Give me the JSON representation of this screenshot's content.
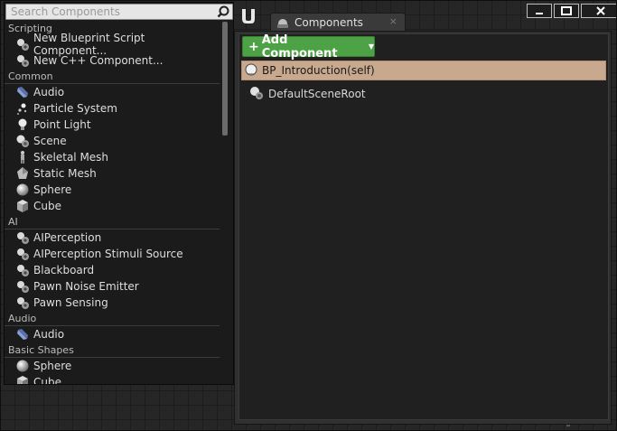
{
  "search": {
    "placeholder": "Search Components",
    "icon": "search-icon"
  },
  "scripting": {
    "header": "Scripting",
    "items": [
      {
        "label": "New Blueprint Script Component...",
        "icon": "blueprint-component-icon"
      },
      {
        "label": "New C++ Component...",
        "icon": "cpp-component-icon"
      }
    ]
  },
  "common": {
    "header": "Common",
    "items": [
      {
        "label": "Audio",
        "icon": "audio-icon"
      },
      {
        "label": "Particle System",
        "icon": "particle-system-icon"
      },
      {
        "label": "Point Light",
        "icon": "point-light-icon"
      },
      {
        "label": "Scene",
        "icon": "scene-icon"
      },
      {
        "label": "Skeletal Mesh",
        "icon": "skeletal-mesh-icon"
      },
      {
        "label": "Static Mesh",
        "icon": "static-mesh-icon"
      },
      {
        "label": "Sphere",
        "icon": "sphere-icon"
      },
      {
        "label": "Cube",
        "icon": "cube-icon"
      }
    ]
  },
  "ai": {
    "header": "AI",
    "items": [
      {
        "label": "AIPerception",
        "icon": "component-icon"
      },
      {
        "label": "AIPerception Stimuli Source",
        "icon": "component-icon"
      },
      {
        "label": "Blackboard",
        "icon": "component-icon"
      },
      {
        "label": "Pawn Noise Emitter",
        "icon": "component-icon"
      },
      {
        "label": "Pawn Sensing",
        "icon": "component-icon"
      }
    ]
  },
  "audio": {
    "header": "Audio",
    "items": [
      {
        "label": "Audio",
        "icon": "audio-icon"
      }
    ]
  },
  "basic_shapes": {
    "header": "Basic Shapes",
    "items": [
      {
        "label": "Sphere",
        "icon": "sphere-icon"
      },
      {
        "label": "Cube",
        "icon": "cube-icon"
      }
    ]
  },
  "window": {
    "tab_label": "Components",
    "tab_close": "×",
    "add_button_plus": "+",
    "add_button_label": "Add Component",
    "add_button_caret": "▼",
    "root_item": "BP_Introduction(self)",
    "child_item": "DefaultSceneRoot"
  },
  "colors": {
    "add_button": "#4ea246",
    "selected_row": "#c8a98e",
    "panel": "#303030",
    "dropdown": "#1b1b1b"
  }
}
